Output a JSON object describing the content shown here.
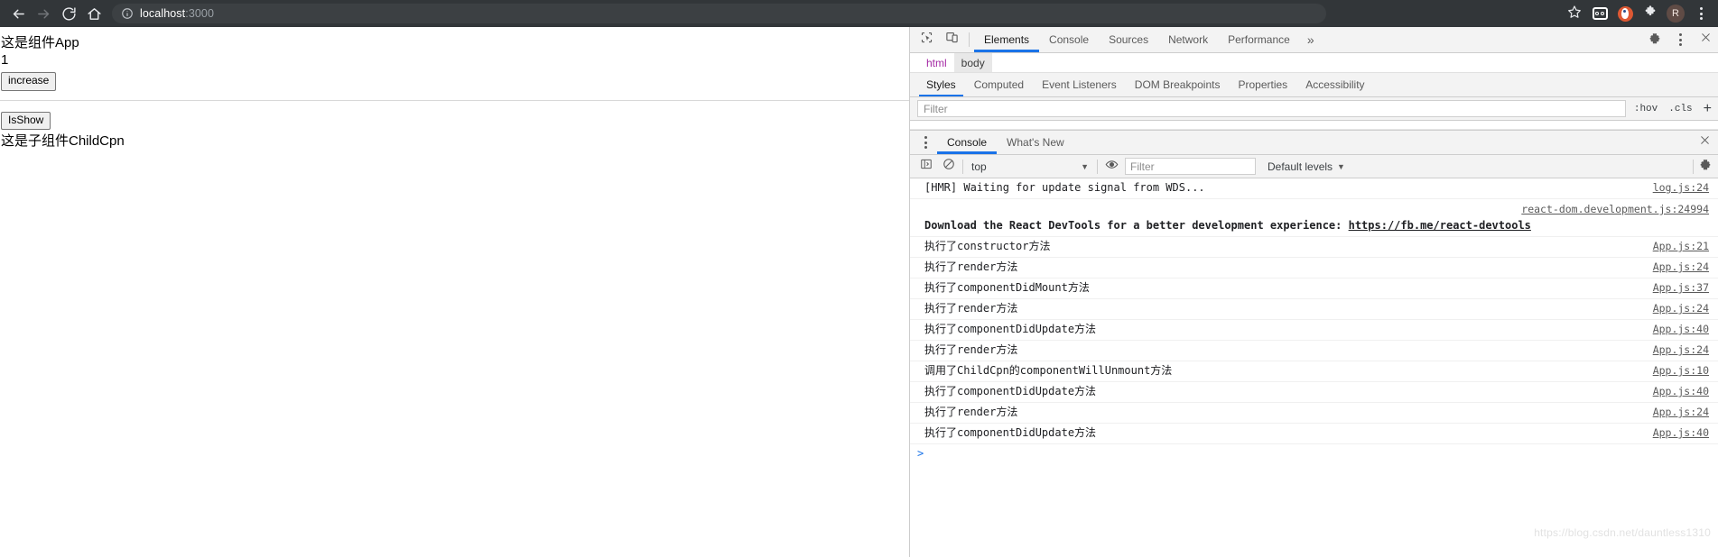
{
  "browser": {
    "back_icon": "back-arrow-icon",
    "forward_icon": "forward-arrow-icon",
    "reload_icon": "reload-icon",
    "home_icon": "home-icon",
    "url_text": "localhost",
    "url_port": ":3000",
    "url_full": "localhost:3000",
    "info_icon": "info-circle-icon",
    "actions": {
      "bookmark": "star-icon",
      "goggles": "goggles-extension-icon",
      "duckduckgo": "duckduckgo-extension-icon",
      "extensions": "puzzle-piece-icon",
      "profile_initial": "R",
      "menu": "three-dot-menu-icon"
    }
  },
  "page": {
    "title": "这是组件App",
    "counter": "1",
    "increase_button": "increase",
    "isshow_button": "IsShow",
    "child_text": "这是子组件ChildCpn"
  },
  "devtools": {
    "inspect_icon": "inspect-element-icon",
    "device_icon": "device-toolbar-icon",
    "tabs": [
      {
        "label": "Elements",
        "active": true
      },
      {
        "label": "Console",
        "active": false
      },
      {
        "label": "Sources",
        "active": false
      },
      {
        "label": "Network",
        "active": false
      },
      {
        "label": "Performance",
        "active": false
      }
    ],
    "more_tabs": "»",
    "settings_icon": "gear-icon",
    "menu_icon": "three-dot-menu-icon",
    "close_icon": "close-icon",
    "breadcrumbs": [
      {
        "label": "html",
        "selected": false
      },
      {
        "label": "body",
        "selected": true
      }
    ],
    "sidebar_tabs": [
      {
        "label": "Styles",
        "active": true
      },
      {
        "label": "Computed",
        "active": false
      },
      {
        "label": "Event Listeners",
        "active": false
      },
      {
        "label": "DOM Breakpoints",
        "active": false
      },
      {
        "label": "Properties",
        "active": false
      },
      {
        "label": "Accessibility",
        "active": false
      }
    ],
    "styles_filter_placeholder": "Filter",
    "hov_button": ":hov",
    "cls_button": ".cls",
    "new_rule_button": "+"
  },
  "drawer": {
    "menu_icon": "three-dot-menu-icon",
    "tabs": [
      {
        "label": "Console",
        "active": true
      },
      {
        "label": "What's New",
        "active": false
      }
    ],
    "close_icon": "close-icon"
  },
  "console_toolbar": {
    "sidebar_icon": "console-sidebar-icon",
    "clear_icon": "clear-console-icon",
    "context_selected": "top",
    "context_caret": "▼",
    "eye_icon": "live-expression-icon",
    "filter_placeholder": "Filter",
    "levels_label": "Default levels",
    "levels_caret": "▼",
    "settings_icon": "gear-icon"
  },
  "console_messages": [
    {
      "text": "[HMR] Waiting for update signal from WDS...",
      "source": "log.js:24",
      "style": "plain"
    },
    {
      "text": "Download the React DevTools for a better development experience: ",
      "link": "https://fb.me/react-devtools",
      "source": "react-dom.development.js:24994",
      "style": "react"
    },
    {
      "text": "执行了constructor方法",
      "source": "App.js:21",
      "style": "plain"
    },
    {
      "text": "执行了render方法",
      "source": "App.js:24",
      "style": "plain"
    },
    {
      "text": "执行了componentDidMount方法",
      "source": "App.js:37",
      "style": "plain"
    },
    {
      "text": "执行了render方法",
      "source": "App.js:24",
      "style": "plain"
    },
    {
      "text": "执行了componentDidUpdate方法",
      "source": "App.js:40",
      "style": "plain"
    },
    {
      "text": "执行了render方法",
      "source": "App.js:24",
      "style": "plain"
    },
    {
      "text": "调用了ChildCpn的componentWillUnmount方法",
      "source": "App.js:10",
      "style": "plain"
    },
    {
      "text": "执行了componentDidUpdate方法",
      "source": "App.js:40",
      "style": "plain"
    },
    {
      "text": "执行了render方法",
      "source": "App.js:24",
      "style": "plain"
    },
    {
      "text": "执行了componentDidUpdate方法",
      "source": "App.js:40",
      "style": "plain"
    }
  ],
  "console_prompt": ">",
  "watermark": "https://blog.csdn.net/dauntless1310",
  "colors": {
    "chrome_bar": "#323639",
    "accent_blue": "#1a73e8",
    "devtools_bg": "#f3f3f3",
    "crumb_purple": "#a428a4"
  }
}
